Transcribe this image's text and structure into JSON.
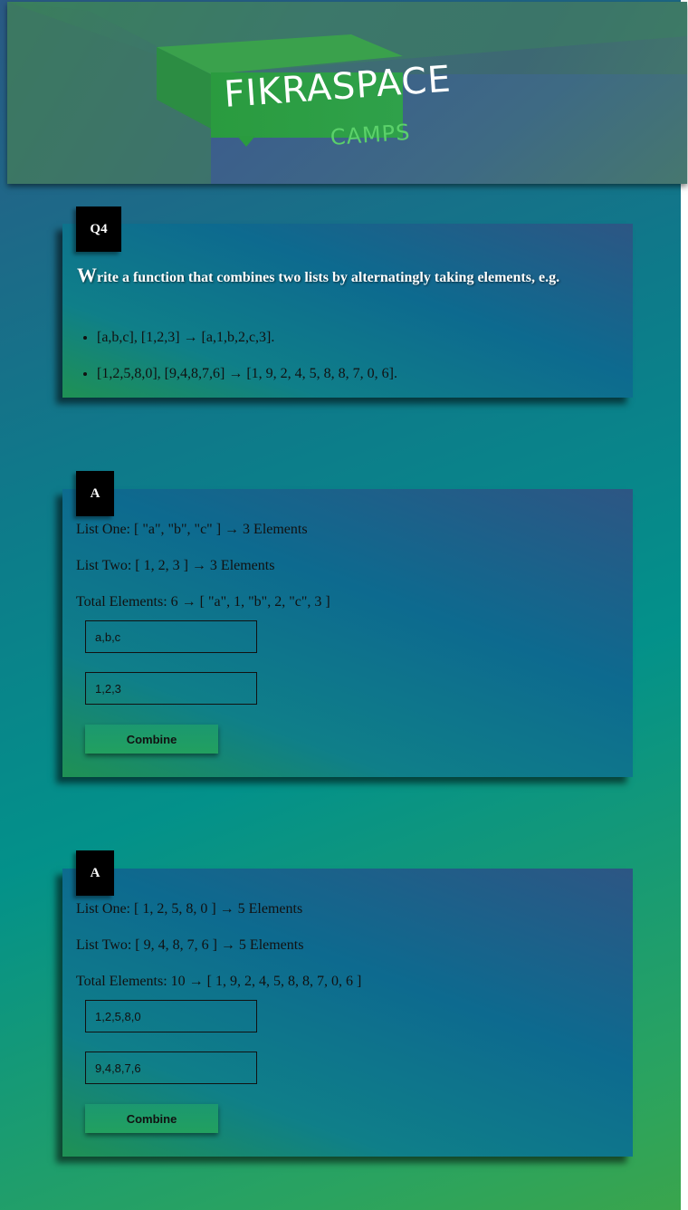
{
  "banner": {
    "logo_part1": "FIKRA",
    "logo_part2": "SPACE",
    "logo_sub": "CAMPS"
  },
  "question": {
    "tag": "Q4",
    "title_first_letter": "W",
    "title_rest": "rite a function that combines two lists by alternatingly taking elements, e.g.",
    "examples": [
      "[a,b,c], [1,2,3] → [a,1,b,2,c,3].",
      "[1,2,5,8,0], [9,4,8,7,6] → [1, 9, 2, 4, 5, 8, 8, 7, 0, 6]."
    ]
  },
  "answers": [
    {
      "tag": "A",
      "list_one": "List One: [ \"a\", \"b\", \"c\" ] → 3 Elements",
      "list_two": "List Two: [ 1, 2, 3 ] → 3 Elements",
      "total": "Total Elements: 6 → [ \"a\", 1, \"b\", 2, \"c\", 3 ]",
      "input_one": "a,b,c",
      "input_two": "1,2,3",
      "button_label": "Combine"
    },
    {
      "tag": "A",
      "list_one": "List One: [ 1, 2, 5, 8, 0 ] → 5 Elements",
      "list_two": "List Two: [ 9, 4, 8, 7, 6 ] → 5 Elements",
      "total": "Total Elements: 10 → [ 1, 9, 2, 4, 5, 8, 8, 7, 0, 6 ]",
      "input_one": "1,2,5,8,0",
      "input_two": "9,4,8,7,6",
      "button_label": "Combine"
    }
  ]
}
